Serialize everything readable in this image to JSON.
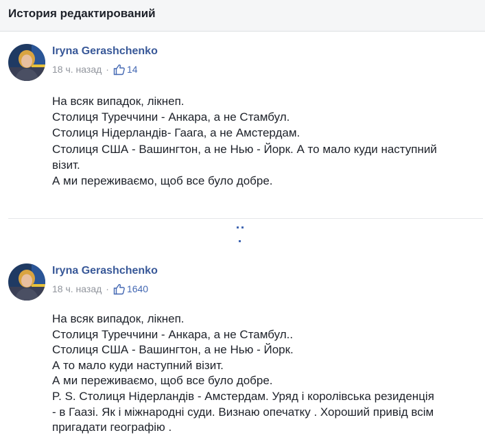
{
  "header": {
    "title": "История редактирований"
  },
  "colors": {
    "link": "#385898",
    "accent": "#4267b2",
    "meta": "#90949c",
    "header_bg": "#f5f6f7"
  },
  "posts": [
    {
      "author": "Iryna Gerashchenko",
      "time": "18 ч. назад",
      "separator": "·",
      "likes": "14",
      "like_icon": "thumbs-up-icon",
      "lines": [
        "На всяк випадок, лікнеп.",
        "Столиця Туреччини - Анкара, а не Стамбул.",
        "Столиця Нідерландів- Гаага, а не Амстердам.",
        "Столиця США - Вашингтон, а не Нью - Йорк. А то мало куди наступний",
        "візит.",
        "А ми переживаємо, щоб все було добре."
      ]
    },
    {
      "author": "Iryna Gerashchenko",
      "time": "18 ч. назад",
      "separator": "·",
      "likes": "1640",
      "like_icon": "thumbs-up-icon",
      "lines": [
        "На всяк випадок, лікнеп.",
        "Столиця Туреччини - Анкара, а не Стамбул..",
        "Столиця США - Вашингтон, а не Нью - Йорк.",
        "А то мало куди наступний візит.",
        "А ми переживаємо, щоб все було добре.",
        "P. S. Столиця Нідерландів - Амстердам. Уряд і королівська резиденція",
        "- в Гаазі. Як і міжнародні суди. Визнаю опечатку . Хороший привід всім",
        "пригадати географію ."
      ]
    }
  ]
}
